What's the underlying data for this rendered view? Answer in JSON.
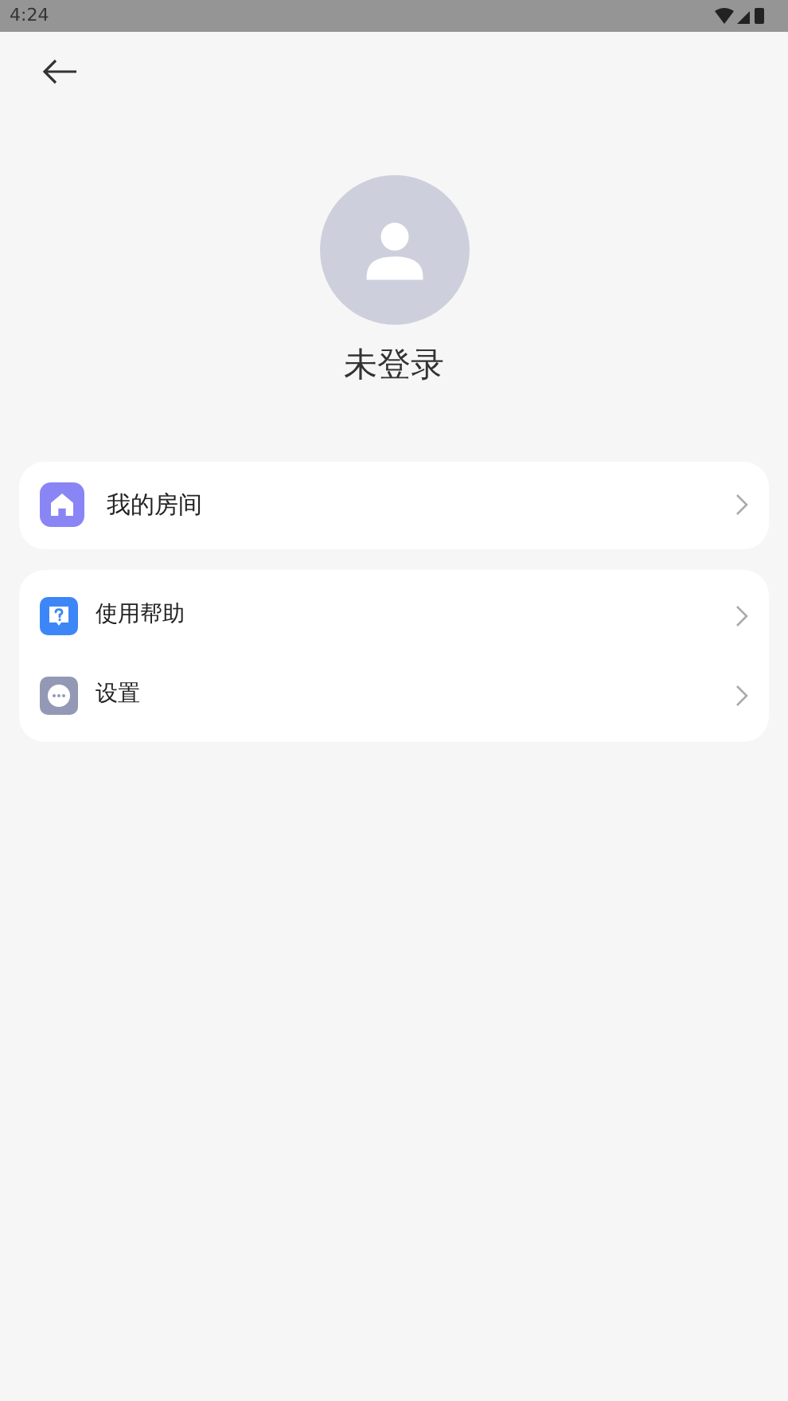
{
  "status_bar": {
    "time": "4:24"
  },
  "profile": {
    "name": "未登录"
  },
  "groups": [
    {
      "items": [
        {
          "kind": "home",
          "label": "我的房间"
        }
      ]
    },
    {
      "items": [
        {
          "kind": "help",
          "label": "使用帮助"
        },
        {
          "kind": "settings",
          "label": "设置"
        }
      ]
    }
  ]
}
